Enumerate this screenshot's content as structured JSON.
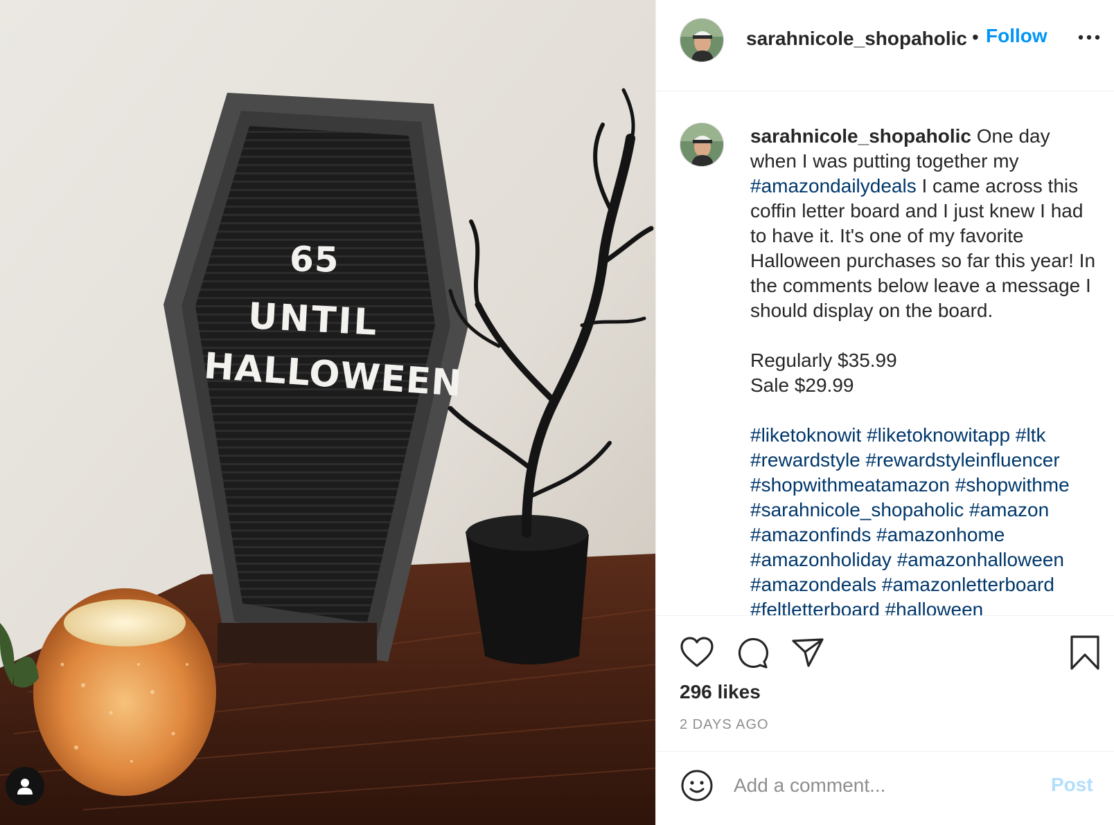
{
  "photo": {
    "board_lines": [
      "65",
      "UNTIL",
      "HALLOWEEN"
    ]
  },
  "header": {
    "username": "sarahnicole_shopaholic",
    "dot": "•",
    "follow_label": "Follow"
  },
  "caption": {
    "username": "sarahnicole_shopaholic",
    "intro": " One day when I was putting together my ",
    "tag_inline": "#amazondailydeals",
    "body": " I came across this coffin letter board and I just knew I had to have it. It's one of my favorite Halloween purchases so far this year! In the comments below leave a message I should display on the board.",
    "price_regular": "Regularly $35.99",
    "price_sale": "Sale $29.99",
    "hashtags": "#liketoknowit #liketoknowitapp #ltk #rewardstyle #rewardstyleinfluencer #shopwithmeatamazon #shopwithme #sarahnicole_shopaholic #amazon #amazonfinds #amazonhome #amazonholiday #amazonhalloween #amazondeals #amazonletterboard #feltletterboard #halloween"
  },
  "engagement": {
    "likes": "296 likes",
    "timestamp": "2 DAYS AGO"
  },
  "comment_bar": {
    "placeholder": "Add a comment...",
    "post_label": "Post"
  },
  "colors": {
    "link_blue": "#0095f6",
    "hashtag_blue": "#00376b",
    "post_disabled": "#b2dffc",
    "muted": "#8e8e8e"
  },
  "icons": [
    "heart-icon",
    "comment-icon",
    "share-icon",
    "bookmark-icon",
    "smiley-icon",
    "more-icon",
    "user-tag-icon"
  ]
}
